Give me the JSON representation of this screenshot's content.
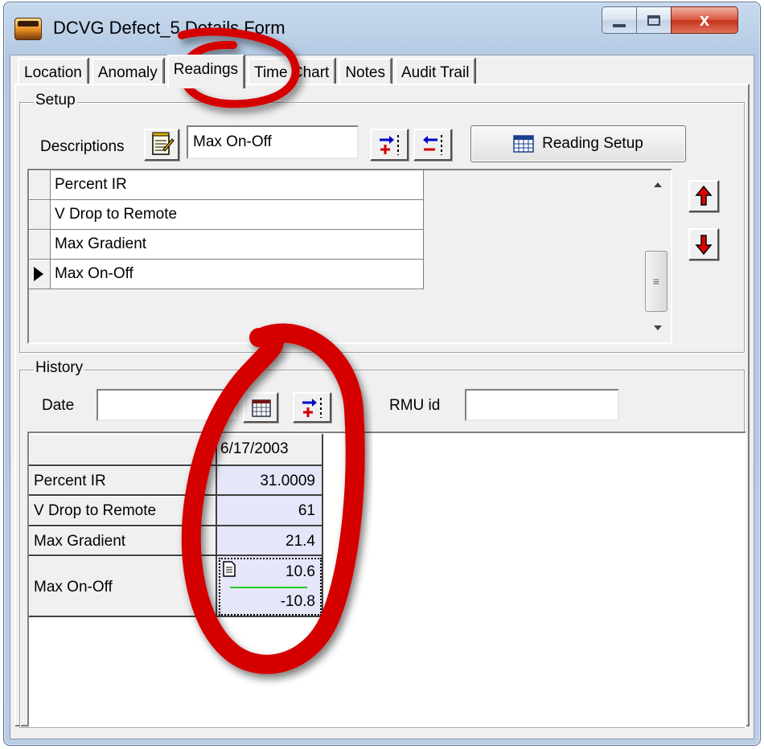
{
  "window": {
    "title": "DCVG Defect_5 Details Form",
    "close_glyph": "x"
  },
  "tabs": [
    {
      "label": "Location"
    },
    {
      "label": "Anomaly"
    },
    {
      "label": "Readings"
    },
    {
      "label": "Time Chart"
    },
    {
      "label": "Notes"
    },
    {
      "label": "Audit Trail"
    }
  ],
  "active_tab": "Readings",
  "setup": {
    "group_label": "Setup",
    "descriptions_label": "Descriptions",
    "descriptions_value": "Max On-Off",
    "reading_setup_label": "Reading Setup",
    "list": [
      {
        "label": "Percent IR",
        "selected": false
      },
      {
        "label": "V Drop to Remote",
        "selected": false
      },
      {
        "label": "Max Gradient",
        "selected": false
      },
      {
        "label": "Max On-Off",
        "selected": true
      }
    ]
  },
  "history": {
    "group_label": "History",
    "date_label": "Date",
    "date_value": "",
    "rmu_label": "RMU id",
    "rmu_value": "",
    "grid": {
      "column_header": "6/17/2003",
      "rows": [
        {
          "label": "Percent IR",
          "value": "31.0009"
        },
        {
          "label": "V Drop to Remote",
          "value": "61"
        },
        {
          "label": "Max Gradient",
          "value": "21.4"
        },
        {
          "label": "Max On-Off",
          "value": "10.6",
          "value2": "-10.8"
        }
      ]
    }
  },
  "colors": {
    "annotation_red": "#d40000",
    "title_gradient": "#b9cde4",
    "cell_value_bg": "#e6e6fa",
    "divider_green": "#22cc22"
  },
  "icons": {
    "describe": "notepad-edit-icon",
    "add_row": "add-row-icon",
    "remove_row": "remove-row-icon",
    "calendar": "calendar-icon",
    "move_up": "red-up-arrow-icon",
    "move_down": "red-down-arrow-icon"
  }
}
